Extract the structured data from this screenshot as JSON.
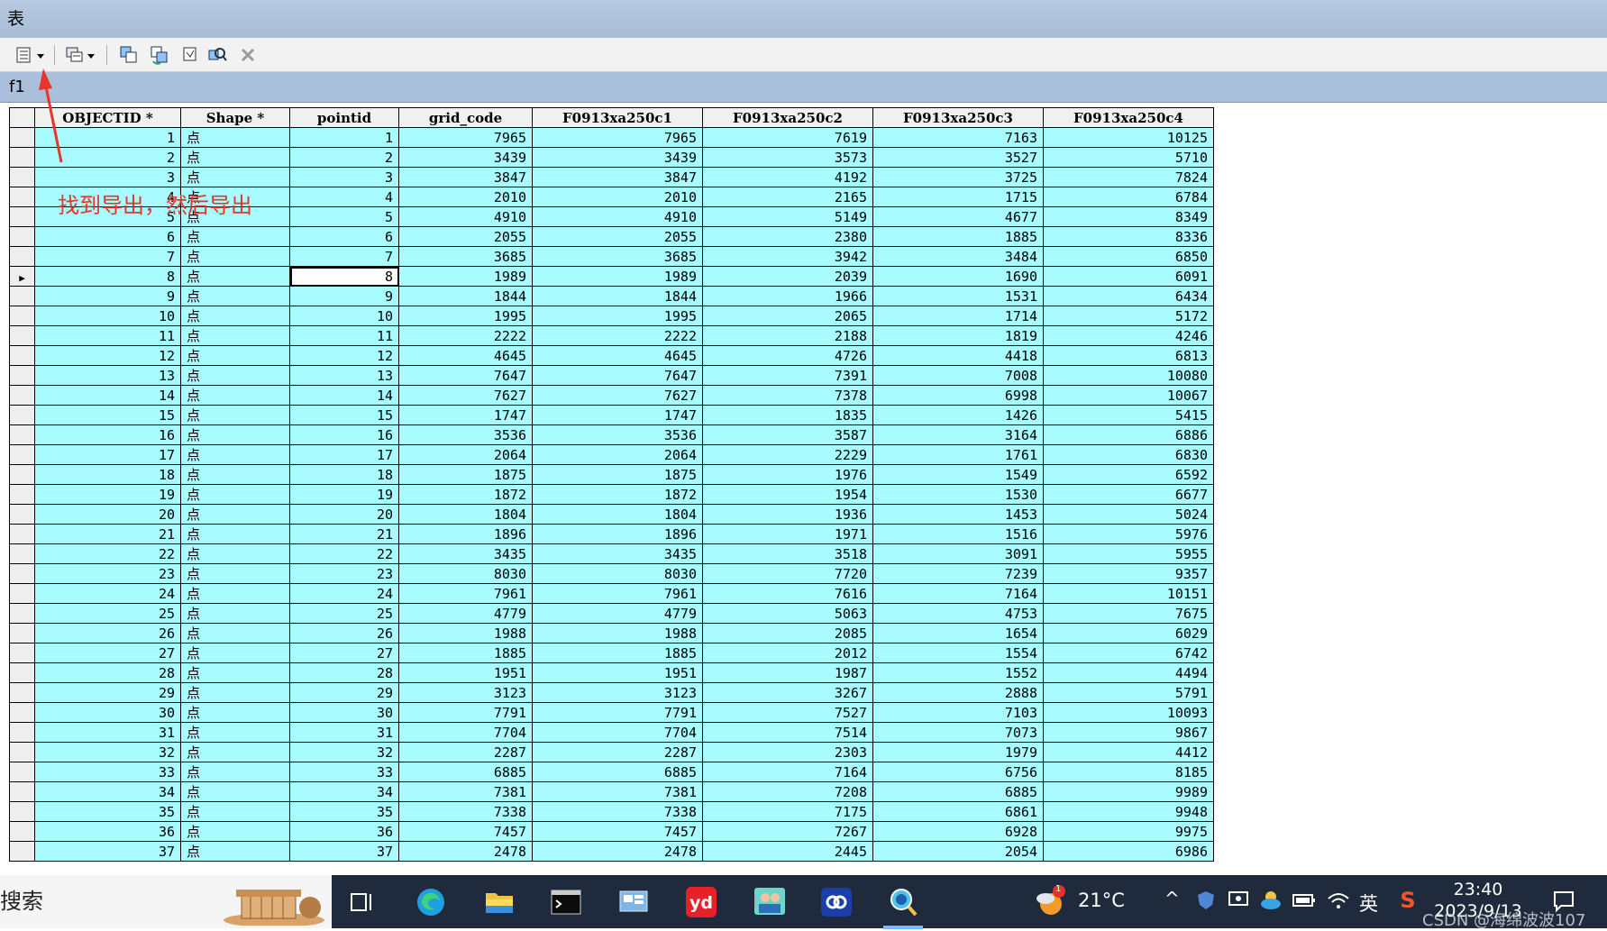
{
  "window": {
    "title": "表"
  },
  "toolbar": {
    "buttons": [
      {
        "name": "table-options-icon"
      },
      {
        "name": "related-tables-icon"
      },
      {
        "name": "select-by-attributes-icon"
      },
      {
        "name": "switch-selection-icon"
      },
      {
        "name": "clear-selection-icon"
      },
      {
        "name": "zoom-to-selected-icon"
      },
      {
        "name": "delete-selected-icon"
      }
    ]
  },
  "tab": {
    "name": "f1"
  },
  "annotation": {
    "text": "找到导出，然后导出",
    "color": "#e8342a"
  },
  "table": {
    "columns": [
      "OBJECTID *",
      "Shape *",
      "pointid",
      "grid_code",
      "F0913xa250c1",
      "F0913xa250c2",
      "F0913xa250c3",
      "F0913xa250c4"
    ],
    "current_row": 8,
    "rows": [
      [
        "1",
        "点",
        "1",
        "7965",
        "7965",
        "7619",
        "7163",
        "10125"
      ],
      [
        "2",
        "点",
        "2",
        "3439",
        "3439",
        "3573",
        "3527",
        "5710"
      ],
      [
        "3",
        "点",
        "3",
        "3847",
        "3847",
        "4192",
        "3725",
        "7824"
      ],
      [
        "4",
        "点",
        "4",
        "2010",
        "2010",
        "2165",
        "1715",
        "6784"
      ],
      [
        "5",
        "点",
        "5",
        "4910",
        "4910",
        "5149",
        "4677",
        "8349"
      ],
      [
        "6",
        "点",
        "6",
        "2055",
        "2055",
        "2380",
        "1885",
        "8336"
      ],
      [
        "7",
        "点",
        "7",
        "3685",
        "3685",
        "3942",
        "3484",
        "6850"
      ],
      [
        "8",
        "点",
        "8",
        "1989",
        "1989",
        "2039",
        "1690",
        "6091"
      ],
      [
        "9",
        "点",
        "9",
        "1844",
        "1844",
        "1966",
        "1531",
        "6434"
      ],
      [
        "10",
        "点",
        "10",
        "1995",
        "1995",
        "2065",
        "1714",
        "5172"
      ],
      [
        "11",
        "点",
        "11",
        "2222",
        "2222",
        "2188",
        "1819",
        "4246"
      ],
      [
        "12",
        "点",
        "12",
        "4645",
        "4645",
        "4726",
        "4418",
        "6813"
      ],
      [
        "13",
        "点",
        "13",
        "7647",
        "7647",
        "7391",
        "7008",
        "10080"
      ],
      [
        "14",
        "点",
        "14",
        "7627",
        "7627",
        "7378",
        "6998",
        "10067"
      ],
      [
        "15",
        "点",
        "15",
        "1747",
        "1747",
        "1835",
        "1426",
        "5415"
      ],
      [
        "16",
        "点",
        "16",
        "3536",
        "3536",
        "3587",
        "3164",
        "6886"
      ],
      [
        "17",
        "点",
        "17",
        "2064",
        "2064",
        "2229",
        "1761",
        "6830"
      ],
      [
        "18",
        "点",
        "18",
        "1875",
        "1875",
        "1976",
        "1549",
        "6592"
      ],
      [
        "19",
        "点",
        "19",
        "1872",
        "1872",
        "1954",
        "1530",
        "6677"
      ],
      [
        "20",
        "点",
        "20",
        "1804",
        "1804",
        "1936",
        "1453",
        "5024"
      ],
      [
        "21",
        "点",
        "21",
        "1896",
        "1896",
        "1971",
        "1516",
        "5976"
      ],
      [
        "22",
        "点",
        "22",
        "3435",
        "3435",
        "3518",
        "3091",
        "5955"
      ],
      [
        "23",
        "点",
        "23",
        "8030",
        "8030",
        "7720",
        "7239",
        "9357"
      ],
      [
        "24",
        "点",
        "24",
        "7961",
        "7961",
        "7616",
        "7164",
        "10151"
      ],
      [
        "25",
        "点",
        "25",
        "4779",
        "4779",
        "5063",
        "4753",
        "7675"
      ],
      [
        "26",
        "点",
        "26",
        "1988",
        "1988",
        "2085",
        "1654",
        "6029"
      ],
      [
        "27",
        "点",
        "27",
        "1885",
        "1885",
        "2012",
        "1554",
        "6742"
      ],
      [
        "28",
        "点",
        "28",
        "1951",
        "1951",
        "1987",
        "1552",
        "4494"
      ],
      [
        "29",
        "点",
        "29",
        "3123",
        "3123",
        "3267",
        "2888",
        "5791"
      ],
      [
        "30",
        "点",
        "30",
        "7791",
        "7791",
        "7527",
        "7103",
        "10093"
      ],
      [
        "31",
        "点",
        "31",
        "7704",
        "7704",
        "7514",
        "7073",
        "9867"
      ],
      [
        "32",
        "点",
        "32",
        "2287",
        "2287",
        "2303",
        "1979",
        "4412"
      ],
      [
        "33",
        "点",
        "33",
        "6885",
        "6885",
        "7164",
        "6756",
        "8185"
      ],
      [
        "34",
        "点",
        "34",
        "7381",
        "7381",
        "7208",
        "6885",
        "9989"
      ],
      [
        "35",
        "点",
        "35",
        "7338",
        "7338",
        "7175",
        "6861",
        "9948"
      ],
      [
        "36",
        "点",
        "36",
        "7457",
        "7457",
        "7267",
        "6928",
        "9975"
      ],
      [
        "37",
        "点",
        "37",
        "2478",
        "2478",
        "2445",
        "2054",
        "6986"
      ]
    ]
  },
  "taskbar": {
    "search_label": "搜索",
    "apps": [
      "task-view-icon",
      "edge-icon",
      "file-explorer-icon",
      "terminal-icon",
      "control-panel-icon",
      "youdao-icon",
      "meeting-icon",
      "cloud-link-icon",
      "arcgis-search-icon"
    ],
    "weather": "21°C",
    "weather_badge": "1",
    "language": "英",
    "time": "23:40",
    "date": "2023/9/13",
    "watermark": "CSDN @海绵波波107"
  }
}
